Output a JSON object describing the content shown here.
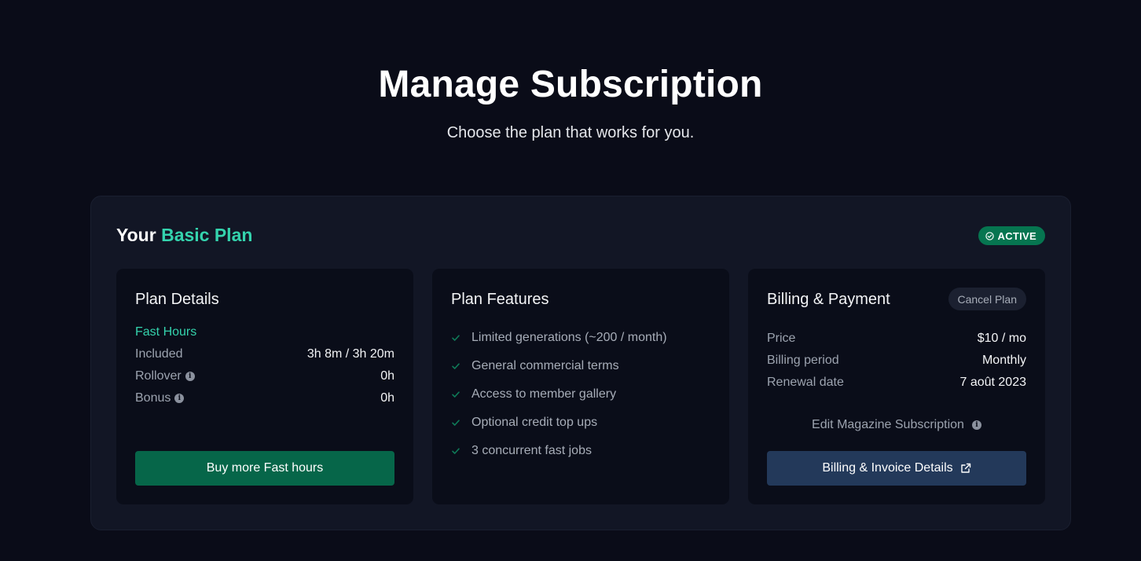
{
  "header": {
    "title": "Manage Subscription",
    "subtitle": "Choose the plan that works for you."
  },
  "plan": {
    "prefix": "Your",
    "name": "Basic Plan",
    "status": "ACTIVE",
    "status_icon": "check-circle-icon"
  },
  "details": {
    "title": "Plan Details",
    "section_label": "Fast Hours",
    "rows": [
      {
        "label": "Included",
        "value": "3h 8m / 3h 20m",
        "info": false
      },
      {
        "label": "Rollover",
        "value": "0h",
        "info": true
      },
      {
        "label": "Bonus",
        "value": "0h",
        "info": true
      }
    ],
    "button": "Buy more Fast hours"
  },
  "features": {
    "title": "Plan Features",
    "items": [
      "Limited generations (~200 / month)",
      "General commercial terms",
      "Access to member gallery",
      "Optional credit top ups",
      "3 concurrent fast jobs"
    ]
  },
  "billing": {
    "title": "Billing & Payment",
    "cancel_label": "Cancel Plan",
    "rows": [
      {
        "label": "Price",
        "value": "$10 / mo"
      },
      {
        "label": "Billing period",
        "value": "Monthly"
      },
      {
        "label": "Renewal date",
        "value": "7 août 2023"
      }
    ],
    "magazine_label": "Edit Magazine Subscription",
    "invoice_button": "Billing & Invoice Details"
  },
  "colors": {
    "background": "#0a0c18",
    "accent": "#34d3ad",
    "active_badge": "#067550",
    "primary_button": "#066649",
    "secondary_button": "#23395a"
  }
}
